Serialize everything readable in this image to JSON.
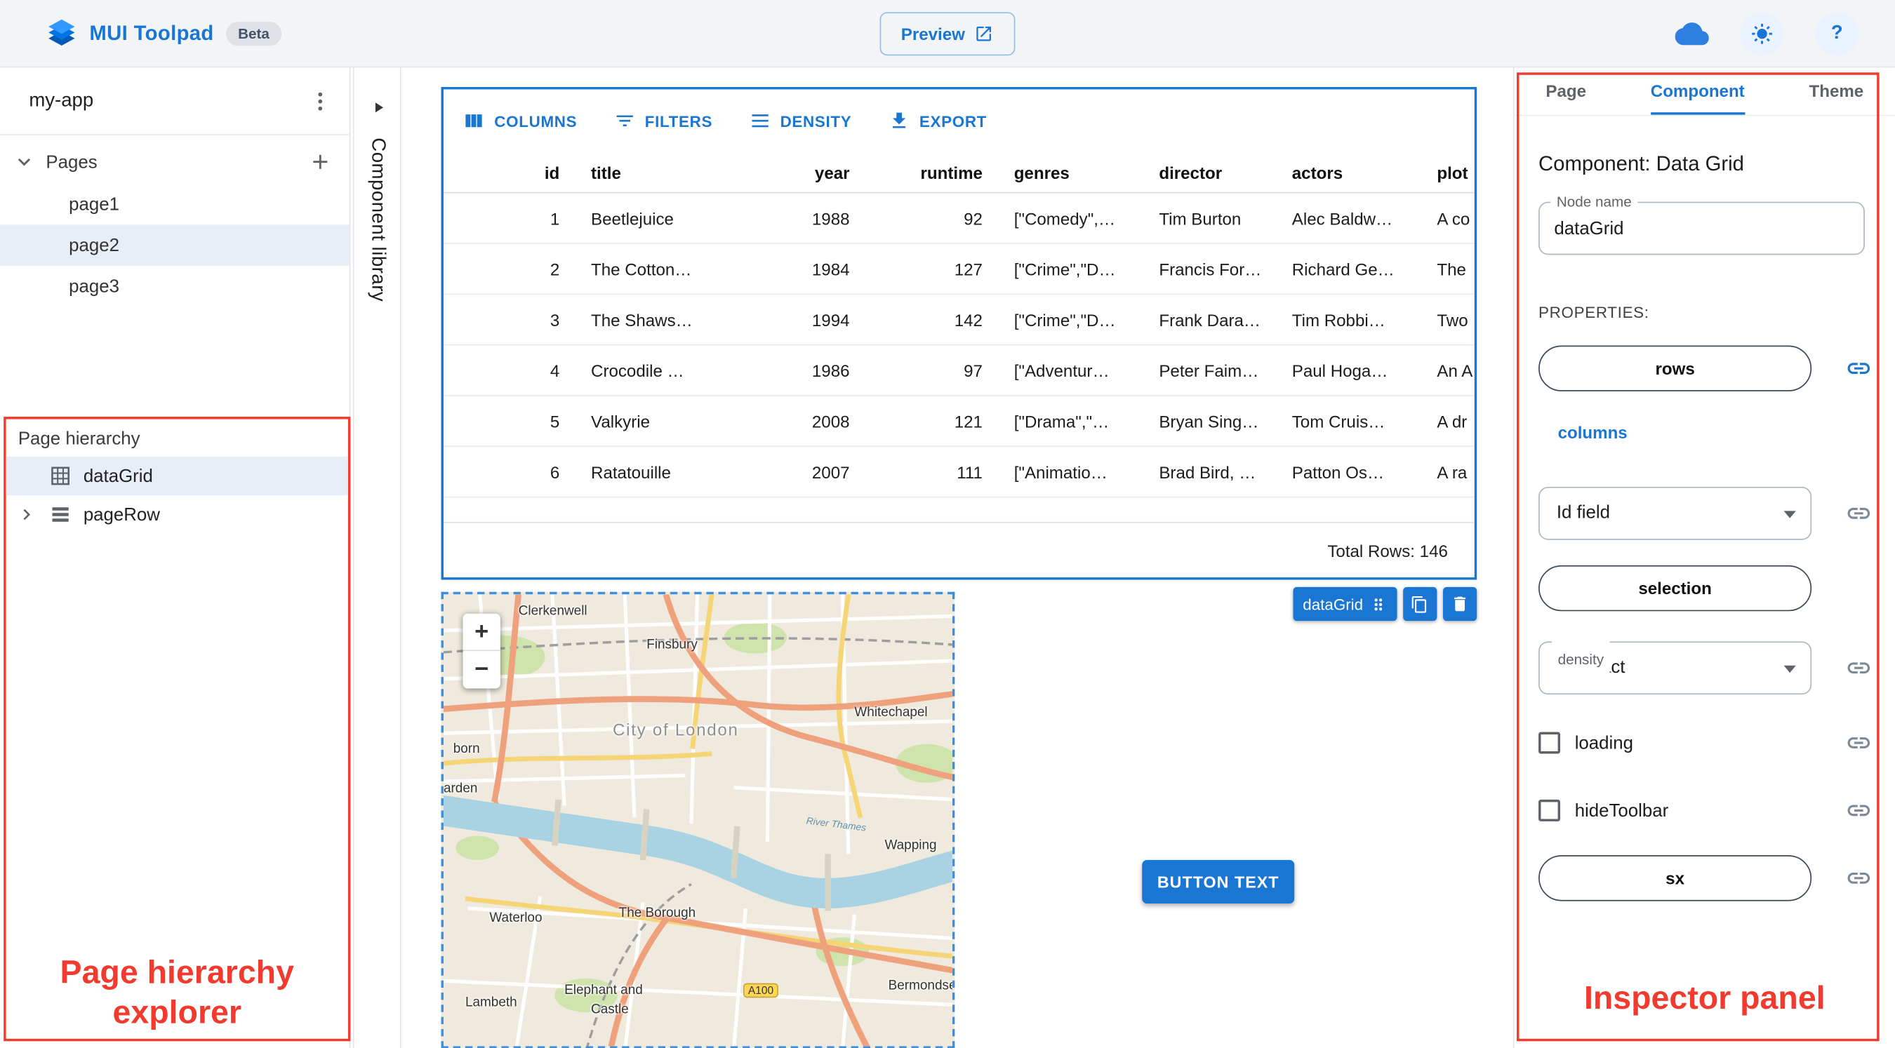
{
  "app_bar": {
    "title": "MUI Toolpad",
    "beta_badge": "Beta",
    "preview_button": "Preview"
  },
  "sidebar": {
    "app_name": "my-app",
    "pages_label": "Pages",
    "pages": [
      {
        "label": "page1"
      },
      {
        "label": "page2"
      },
      {
        "label": "page3"
      }
    ]
  },
  "hierarchy": {
    "title": "Page hierarchy",
    "items": [
      {
        "label": "dataGrid"
      },
      {
        "label": "pageRow"
      }
    ],
    "annotation": "Page hierarchy explorer"
  },
  "component_library": {
    "label": "Component library"
  },
  "data_grid": {
    "toolbar": {
      "columns": "COLUMNS",
      "filters": "FILTERS",
      "density": "DENSITY",
      "export": "EXPORT"
    },
    "headers": [
      "id",
      "title",
      "year",
      "runtime",
      "genres",
      "director",
      "actors",
      "plot"
    ],
    "rows": [
      [
        "1",
        "Beetlejuice",
        "1988",
        "92",
        "[\"Comedy\",…",
        "Tim Burton",
        "Alec Baldw…",
        "A co"
      ],
      [
        "2",
        "The Cotton…",
        "1984",
        "127",
        "[\"Crime\",\"D…",
        "Francis For…",
        "Richard Ge…",
        "The"
      ],
      [
        "3",
        "The Shaws…",
        "1994",
        "142",
        "[\"Crime\",\"D…",
        "Frank Dara…",
        "Tim Robbi…",
        "Two"
      ],
      [
        "4",
        "Crocodile …",
        "1986",
        "97",
        "[\"Adventur…",
        "Peter Faim…",
        "Paul Hoga…",
        "An A"
      ],
      [
        "5",
        "Valkyrie",
        "2008",
        "121",
        "[\"Drama\",\"…",
        "Bryan Sing…",
        "Tom Cruis…",
        "A dr"
      ],
      [
        "6",
        "Ratatouille",
        "2007",
        "111",
        "[\"Animatio…",
        "Brad Bird, …",
        "Patton Os…",
        "A ra"
      ]
    ],
    "footer": "Total Rows: 146",
    "selection_tag": "dataGrid"
  },
  "map": {
    "zoom_in": "+",
    "zoom_out": "−",
    "labels": [
      "Clerkenwell",
      "Finsbury",
      "Whitechapel",
      "City of London",
      "Wapping",
      "The Borough",
      "Waterloo",
      "Lambeth",
      "Elephant and",
      "Castle",
      "Bermondse",
      "born",
      "arden",
      "River Thames"
    ],
    "road_badge": "A100"
  },
  "button_component": {
    "label": "BUTTON TEXT"
  },
  "inspector": {
    "tabs": [
      "Page",
      "Component",
      "Theme"
    ],
    "heading": "Component: Data Grid",
    "node_name_label": "Node name",
    "node_name_value": "dataGrid",
    "properties_label": "PROPERTIES:",
    "rows_prop": "rows",
    "columns_prop": "columns",
    "id_field_value": "Id field",
    "selection_prop": "selection",
    "density_label": "density",
    "density_value": "compact",
    "loading_prop": "loading",
    "hide_toolbar_prop": "hideToolbar",
    "sx_prop": "sx",
    "annotation": "Inspector panel"
  }
}
